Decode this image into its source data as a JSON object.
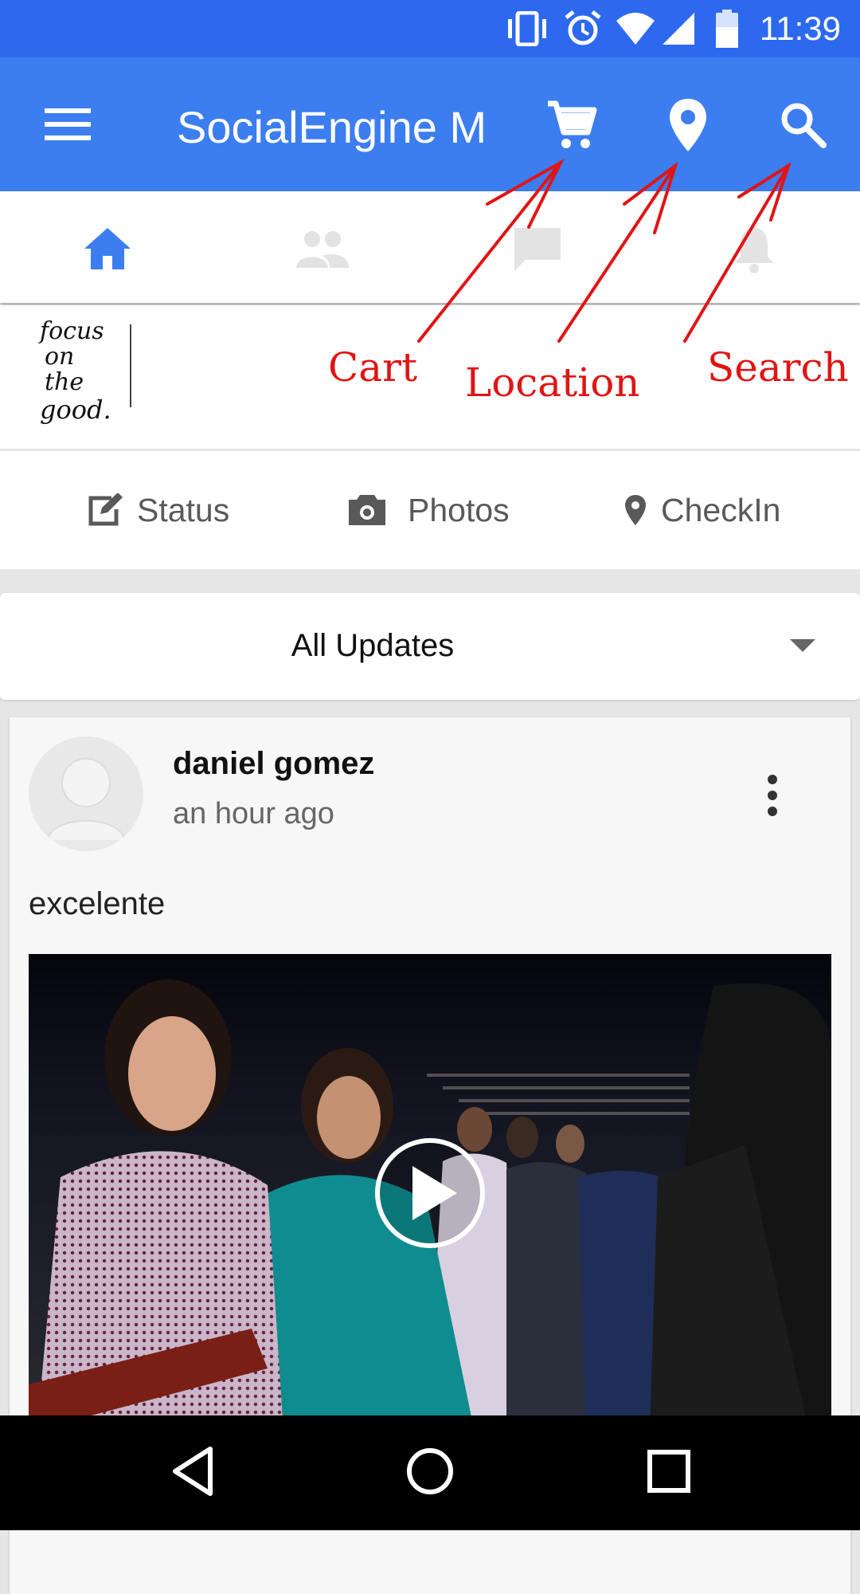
{
  "status_bar": {
    "time": "11:39",
    "icons": [
      "vibrate-icon",
      "alarm-icon",
      "wifi-icon",
      "signal-icon",
      "battery-icon"
    ]
  },
  "app_bar": {
    "menu_icon": "menu-icon",
    "title": "SocialEngine M",
    "actions": [
      "cart-icon",
      "location-pin-icon",
      "search-icon"
    ]
  },
  "tabs": [
    {
      "icon": "home-icon",
      "active": true
    },
    {
      "icon": "friends-icon",
      "active": false
    },
    {
      "icon": "chat-icon",
      "active": false
    },
    {
      "icon": "bell-icon",
      "active": false
    }
  ],
  "cover": {
    "logo_text": "focus on the good"
  },
  "annotations": {
    "cart": "Cart",
    "location": "Location",
    "search": "Search"
  },
  "composer": {
    "status": "Status",
    "photos": "Photos",
    "checkin": "CheckIn"
  },
  "feed_filter": {
    "selected": "All Updates"
  },
  "post": {
    "author": "daniel gomez",
    "time": "an hour ago",
    "text": "excelente"
  },
  "colors": {
    "status_bar": "#2d69ee",
    "app_bar": "#3c7df0",
    "annotation": "#e11414",
    "tab_active": "#3c7df0",
    "tab_inactive": "#e3e3e3"
  }
}
